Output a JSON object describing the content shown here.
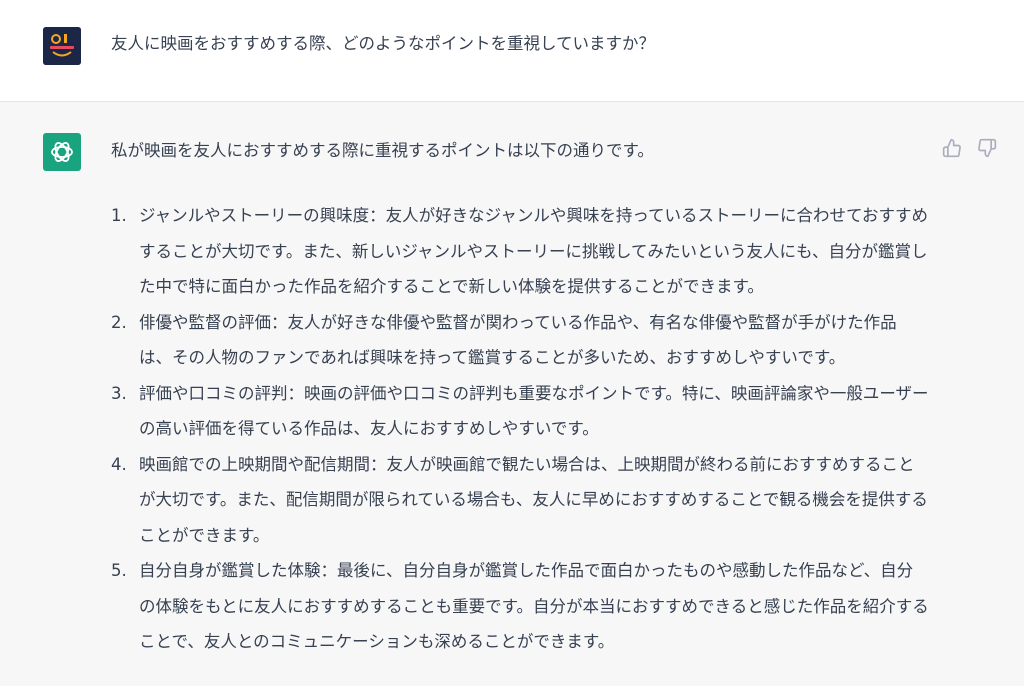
{
  "user": {
    "avatar_icon": "ai-market-logo-icon",
    "message": "友人に映画をおすすめする際、どのようなポイントを重視していますか？"
  },
  "assistant": {
    "avatar_icon": "chatgpt-logo-icon",
    "feedback": {
      "thumb_up_icon": "thumbs-up-icon",
      "thumb_down_icon": "thumbs-down-icon"
    },
    "intro": "私が映画を友人におすすめする際に重視するポイントは以下の通りです。",
    "items": [
      {
        "num": "1.",
        "text": "ジャンルやストーリーの興味度：友人が好きなジャンルや興味を持っているストーリーに合わせておすすめすることが大切です。また、新しいジャンルやストーリーに挑戦してみたいという友人にも、自分が鑑賞した中で特に面白かった作品を紹介することで新しい体験を提供することができます。"
      },
      {
        "num": "2.",
        "text": "俳優や監督の評価：友人が好きな俳優や監督が関わっている作品や、有名な俳優や監督が手がけた作品は、その人物のファンであれば興味を持って鑑賞することが多いため、おすすめしやすいです。"
      },
      {
        "num": "3.",
        "text": "評価や口コミの評判：映画の評価や口コミの評判も重要なポイントです。特に、映画評論家や一般ユーザーの高い評価を得ている作品は、友人におすすめしやすいです。"
      },
      {
        "num": "4.",
        "text": "映画館での上映期間や配信期間：友人が映画館で観たい場合は、上映期間が終わる前におすすめすることが大切です。また、配信期間が限られている場合も、友人に早めにおすすめすることで観る機会を提供することができます。"
      },
      {
        "num": "5.",
        "text": "自分自身が鑑賞した体験：最後に、自分自身が鑑賞した作品で面白かったものや感動した作品など、自分の体験をもとに友人におすすめすることも重要です。自分が本当におすすめできると感じた作品を紹介することで、友人とのコミュニケーションも深めることができます。"
      }
    ]
  },
  "colors": {
    "user_bg": "#ffffff",
    "assistant_bg": "#f7f7f8",
    "text": "#374151",
    "gpt_green": "#19a37f",
    "avatar_navy": "#1c2748"
  }
}
